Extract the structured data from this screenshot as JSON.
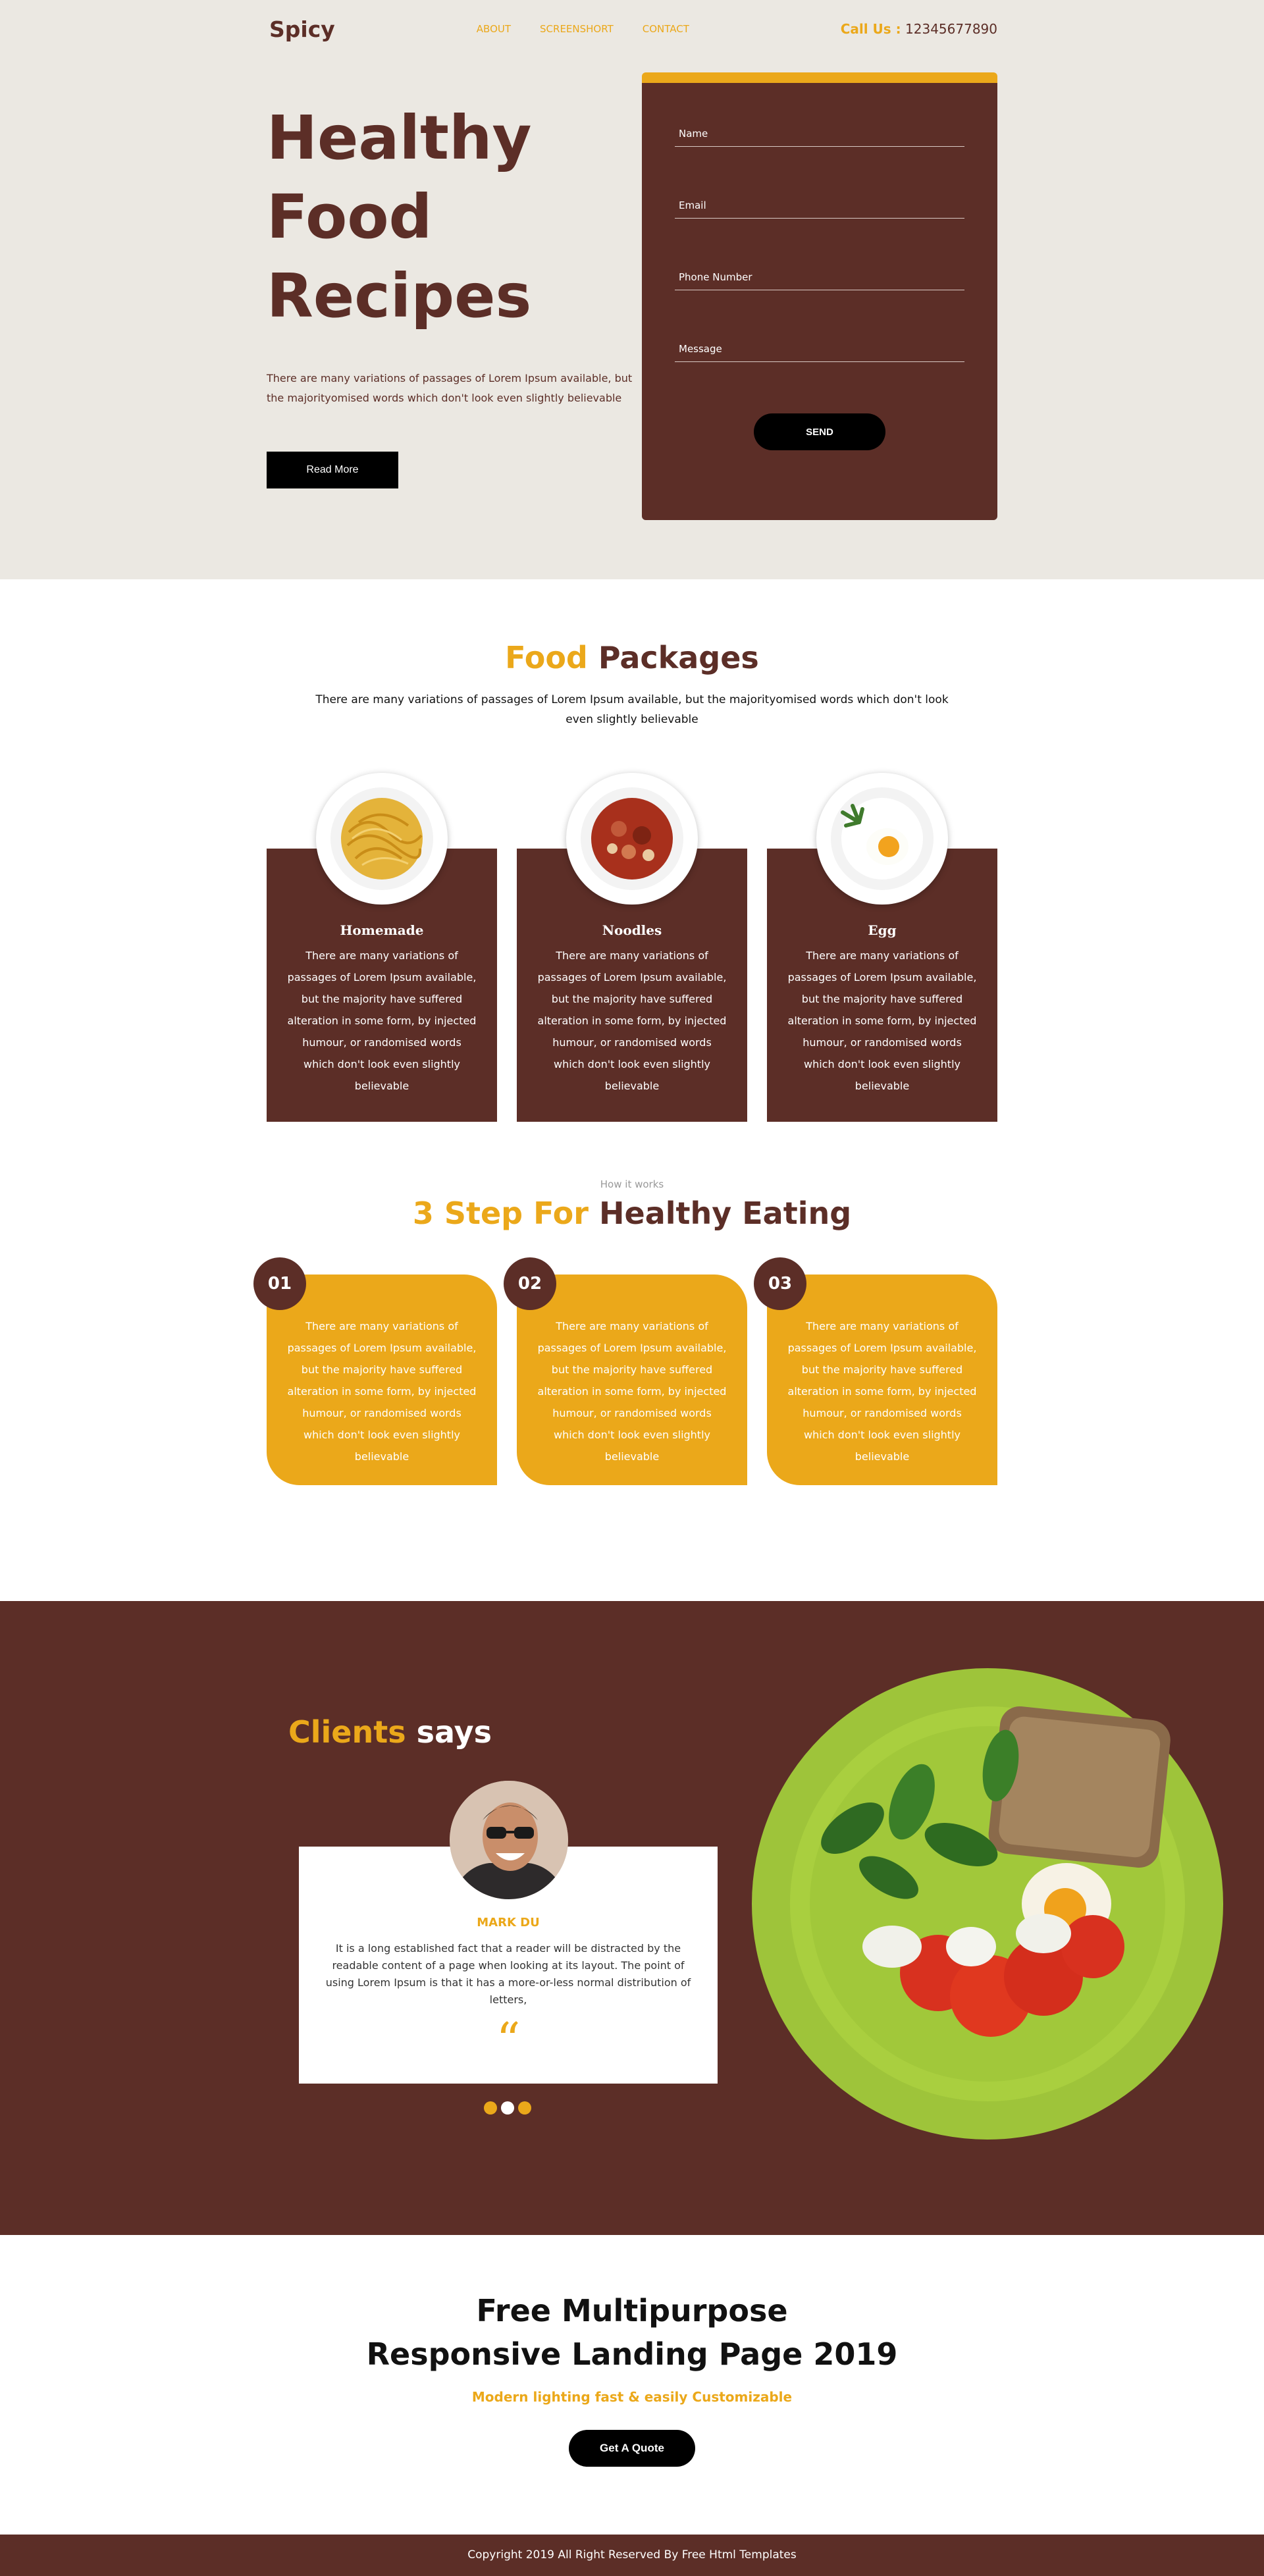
{
  "nav": {
    "logo": "Spicy",
    "links": [
      "ABOUT",
      "SCREENSHORT",
      "CONTACT"
    ],
    "call_label": "Call Us :",
    "call_number": "12345677890"
  },
  "hero": {
    "title_lines": [
      "Healthy",
      "Food",
      "Recipes"
    ],
    "text": "There are many variations of passages of Lorem Ipsum available, but the majorityomised words which don't look even slightly believable",
    "read_more": "Read More"
  },
  "form": {
    "fields": [
      "Name",
      "Email",
      "Phone Number",
      "Message"
    ],
    "send": "SEND"
  },
  "packages": {
    "title_accent": "Food",
    "title_rest": "Packages",
    "subtitle": "There are many variations of passages of Lorem Ipsum available, but the majorityomised words which don't look even slightly believable",
    "items": [
      {
        "name": "Homemade",
        "text": "There are many variations of passages of Lorem Ipsum available, but the majority have suffered alteration in some form, by injected humour, or randomised words which don't look even slightly believable",
        "icon": "noodle-plate-icon"
      },
      {
        "name": "Noodles",
        "text": "There are many variations of passages of Lorem Ipsum available, but the majority have suffered alteration in some form, by injected humour, or randomised words which don't look even slightly believable",
        "icon": "soup-plate-icon"
      },
      {
        "name": "Egg",
        "text": "There are many variations of passages of Lorem Ipsum available, but the majority have suffered alteration in some form, by injected humour, or randomised words which don't look even slightly believable",
        "icon": "egg-plate-icon"
      }
    ]
  },
  "steps": {
    "kicker": "How it works",
    "title_accent": "3 Step For",
    "title_rest": "Healthy Eating",
    "items": [
      {
        "num": "01",
        "text": "There are many variations of passages of Lorem Ipsum available, but the majority have suffered alteration in some form, by injected humour, or randomised words which don't look even slightly believable"
      },
      {
        "num": "02",
        "text": "There are many variations of passages of Lorem Ipsum available, but the majority have suffered alteration in some form, by injected humour, or randomised words which don't look even slightly believable"
      },
      {
        "num": "03",
        "text": "There are many variations of passages of Lorem Ipsum available, but the majority have suffered alteration in some form, by injected humour, or randomised words which don't look even slightly believable"
      }
    ]
  },
  "clients": {
    "title_accent": "Clients",
    "title_rest": "says",
    "name": "MARK DU",
    "text": "It is a long established fact that a reader will be distracted by the readable content of a page when looking at its layout. The point of using Lorem Ipsum is that it has a more-or-less normal distribution of letters,",
    "quote_mark": "“",
    "dots": 3,
    "active_dot": 2
  },
  "cta": {
    "title_line1": "Free Multipurpose",
    "title_line2": "Responsive Landing Page 2019",
    "subtitle": "Modern lighting fast & easily Customizable",
    "button": "Get A Quote"
  },
  "footer": {
    "copyright": "Copyright 2019 All Right Reserved By Free Html Templates"
  },
  "colors": {
    "brown": "#5c2e27",
    "gold": "#eba81a",
    "hero_bg": "#ebe8e2"
  }
}
